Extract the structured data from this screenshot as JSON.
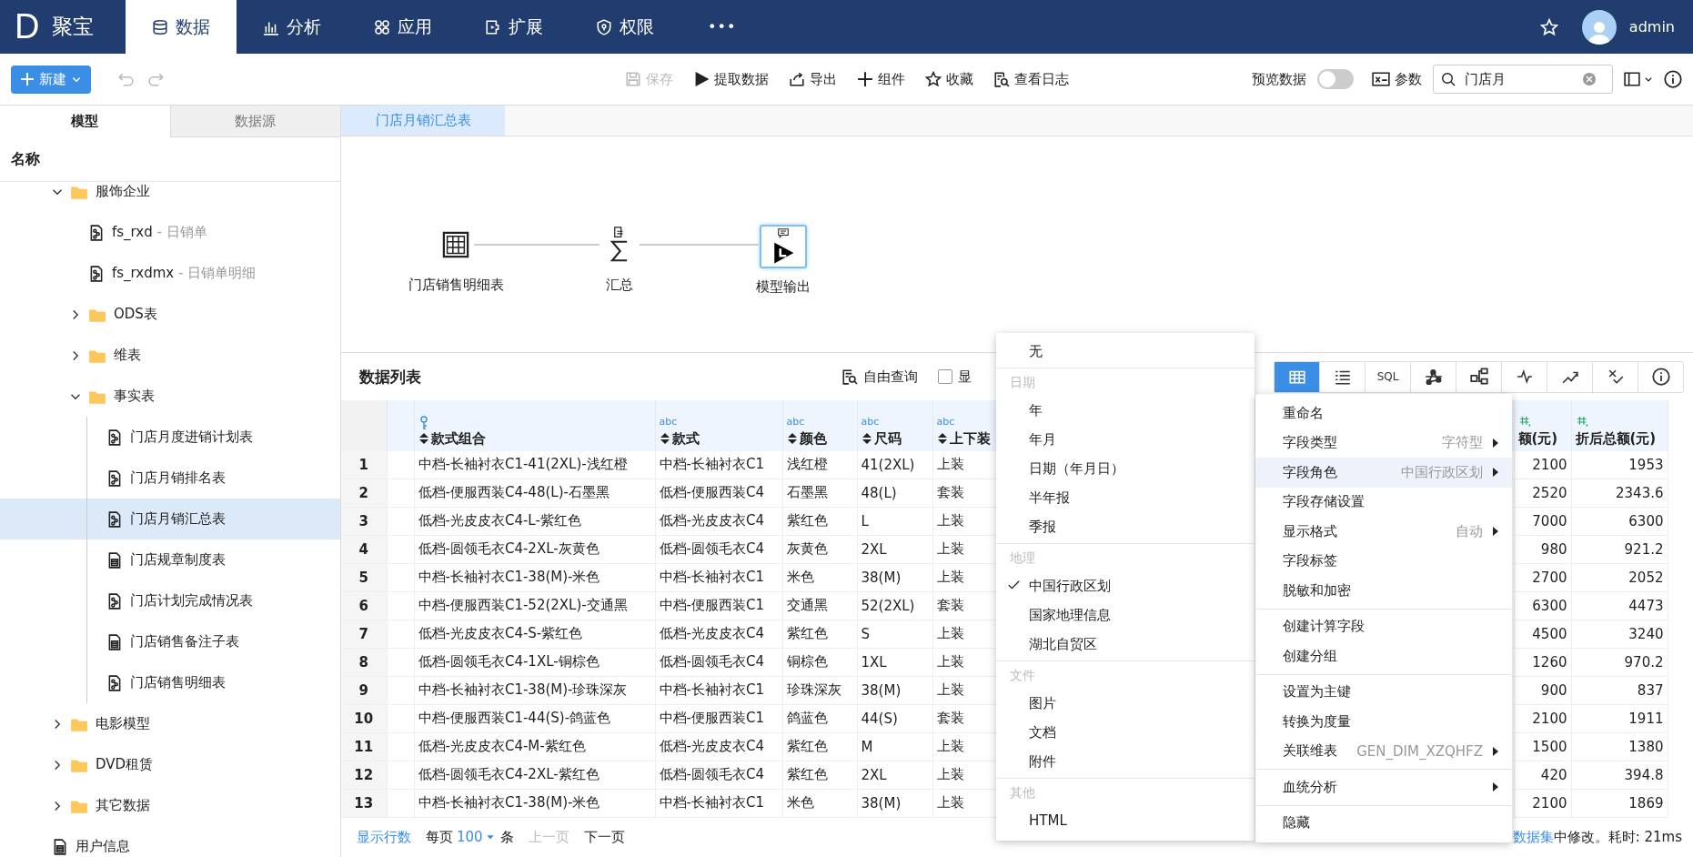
{
  "app": {
    "logo": "D",
    "name": "聚宝"
  },
  "nav": [
    {
      "label": "数据",
      "selected": true
    },
    {
      "label": "分析",
      "selected": false
    },
    {
      "label": "应用",
      "selected": false
    },
    {
      "label": "扩展",
      "selected": false
    },
    {
      "label": "权限",
      "selected": false
    }
  ],
  "nav_more": "•••",
  "user": {
    "name": "admin"
  },
  "toolbar": {
    "new_label": "新建",
    "actions": [
      {
        "label": "保存",
        "disabled": true
      },
      {
        "label": "提取数据",
        "disabled": false
      },
      {
        "label": "导出",
        "disabled": false
      },
      {
        "label": "组件",
        "disabled": false
      },
      {
        "label": "收藏",
        "disabled": false
      },
      {
        "label": "查看日志",
        "disabled": false
      }
    ],
    "preview": {
      "label": "预览数据",
      "on": false
    },
    "params_label": "参数",
    "search": {
      "value": "门店月"
    }
  },
  "sidebar": {
    "tabs": [
      {
        "label": "模型",
        "selected": true
      },
      {
        "label": "数据源",
        "selected": false
      }
    ],
    "header": "名称",
    "tree": [
      {
        "name": "服饰企业",
        "kind": "folder",
        "expanded": true,
        "selected": false,
        "children": [
          {
            "name": "fs_rxd",
            "desc": "- 日销单",
            "kind": "model",
            "selected": false
          },
          {
            "name": "fs_rxdmx",
            "desc": "- 日销单明细",
            "kind": "model",
            "selected": false
          },
          {
            "name": "ODS表",
            "kind": "folder",
            "expanded": false,
            "selected": false
          },
          {
            "name": "维表",
            "kind": "folder",
            "expanded": false,
            "selected": false
          },
          {
            "name": "事实表",
            "kind": "folder",
            "expanded": true,
            "selected": false,
            "children": [
              {
                "name": "门店月度进销计划表",
                "kind": "model",
                "selected": false
              },
              {
                "name": "门店月销排名表",
                "kind": "model",
                "selected": false
              },
              {
                "name": "门店月销汇总表",
                "kind": "model",
                "selected": true
              },
              {
                "name": "门店规章制度表",
                "kind": "table",
                "selected": false
              },
              {
                "name": "门店计划完成情况表",
                "kind": "model",
                "selected": false
              },
              {
                "name": "门店销售备注子表",
                "kind": "table",
                "selected": false
              },
              {
                "name": "门店销售明细表",
                "kind": "model",
                "selected": false
              }
            ]
          }
        ]
      },
      {
        "name": "电影模型",
        "kind": "folder",
        "expanded": false,
        "selected": false
      },
      {
        "name": "DVD租赁",
        "kind": "folder",
        "expanded": false,
        "selected": false
      },
      {
        "name": "其它数据",
        "kind": "folder",
        "expanded": false,
        "selected": false
      },
      {
        "name": "用户信息",
        "kind": "table",
        "selected": false
      }
    ]
  },
  "editor_tabs": [
    {
      "label": "门店月销汇总表",
      "selected": true
    }
  ],
  "flow": {
    "nodes": [
      {
        "label": "门店销售明细表",
        "kind": "source"
      },
      {
        "label": "汇总",
        "kind": "sum"
      },
      {
        "label": "模型输出",
        "kind": "output",
        "selected": true
      }
    ]
  },
  "data_list": {
    "title": "数据列表",
    "query_label": "自由查询",
    "show_checkbox": {
      "label": "显",
      "checked": false
    },
    "views": [
      {
        "selected": true
      },
      {
        "selected": false
      },
      {
        "label": "SQL",
        "selected": false
      },
      {
        "selected": false
      },
      {
        "selected": false
      },
      {
        "selected": false
      },
      {
        "selected": false
      },
      {
        "selected": false
      },
      {
        "selected": false
      }
    ],
    "columns": [
      {
        "label": "款式组合",
        "kind": "key"
      },
      {
        "label": "款式",
        "kind": "text",
        "type": "abc"
      },
      {
        "label": "颜色",
        "kind": "text",
        "type": "abc"
      },
      {
        "label": "尺码",
        "kind": "text",
        "type": "abc"
      },
      {
        "label": "上下装",
        "kind": "text",
        "type": "abc"
      },
      {
        "label": "额(元)",
        "kind": "number"
      },
      {
        "label": "折后总额(元)",
        "kind": "number"
      }
    ],
    "rows": [
      {
        "num": "1",
        "cells": [
          "中档-长袖衬衣C1-41(2XL)-浅红橙",
          "中档-长袖衬衣C1",
          "浅红橙",
          "41(2XL)",
          "上装",
          "2100",
          "1953"
        ]
      },
      {
        "num": "2",
        "cells": [
          "低档-便服西装C4-48(L)-石墨黑",
          "低档-便服西装C4",
          "石墨黑",
          "48(L)",
          "套装",
          "2520",
          "2343.6"
        ]
      },
      {
        "num": "3",
        "cells": [
          "低档-光皮皮衣C4-L-紫红色",
          "低档-光皮皮衣C4",
          "紫红色",
          "L",
          "上装",
          "7000",
          "6300"
        ]
      },
      {
        "num": "4",
        "cells": [
          "低档-圆领毛衣C4-2XL-灰黄色",
          "低档-圆领毛衣C4",
          "灰黄色",
          "2XL",
          "上装",
          "980",
          "921.2"
        ]
      },
      {
        "num": "5",
        "cells": [
          "中档-长袖衬衣C1-38(M)-米色",
          "中档-长袖衬衣C1",
          "米色",
          "38(M)",
          "上装",
          "2700",
          "2052"
        ]
      },
      {
        "num": "6",
        "cells": [
          "中档-便服西装C1-52(2XL)-交通黑",
          "中档-便服西装C1",
          "交通黑",
          "52(2XL)",
          "套装",
          "6300",
          "4473"
        ]
      },
      {
        "num": "7",
        "cells": [
          "低档-光皮皮衣C4-S-紫红色",
          "低档-光皮皮衣C4",
          "紫红色",
          "S",
          "上装",
          "4500",
          "3240"
        ]
      },
      {
        "num": "8",
        "cells": [
          "低档-圆领毛衣C4-1XL-铜棕色",
          "低档-圆领毛衣C4",
          "铜棕色",
          "1XL",
          "上装",
          "1260",
          "970.2"
        ]
      },
      {
        "num": "9",
        "cells": [
          "中档-长袖衬衣C1-38(M)-珍珠深灰",
          "中档-长袖衬衣C1",
          "珍珠深灰",
          "38(M)",
          "上装",
          "900",
          "837"
        ]
      },
      {
        "num": "10",
        "cells": [
          "中档-便服西装C1-44(S)-鸽蓝色",
          "中档-便服西装C1",
          "鸽蓝色",
          "44(S)",
          "套装",
          "2100",
          "1911"
        ]
      },
      {
        "num": "11",
        "cells": [
          "低档-光皮皮衣C4-M-紫红色",
          "低档-光皮皮衣C4",
          "紫红色",
          "M",
          "上装",
          "1500",
          "1380"
        ]
      },
      {
        "num": "12",
        "cells": [
          "低档-圆领毛衣C4-2XL-紫红色",
          "低档-圆领毛衣C4",
          "紫红色",
          "2XL",
          "上装",
          "420",
          "394.8"
        ]
      },
      {
        "num": "13",
        "cells": [
          "中档-长袖衬衣C1-38(M)-米色",
          "中档-长袖衬衣C1",
          "米色",
          "38(M)",
          "上装",
          "2100",
          "1869"
        ]
      }
    ],
    "footer": {
      "rows_link": "显示行数",
      "per_page": "每页",
      "page_size": "100",
      "unit": "条",
      "prev": "上一页",
      "prev_disabled": true,
      "next": "下一页",
      "next_disabled": false,
      "status_link": "数据集",
      "status_text": "中修改。耗时: 21ms"
    }
  },
  "role_menu": {
    "sections": [
      {
        "items": [
          {
            "label": "无",
            "checked": false
          }
        ]
      },
      {
        "heading": "日期",
        "items": [
          {
            "label": "年",
            "checked": false
          },
          {
            "label": "年月",
            "checked": false
          },
          {
            "label": "日期（年月日）",
            "checked": false
          },
          {
            "label": "半年报",
            "checked": false
          },
          {
            "label": "季报",
            "checked": false
          }
        ]
      },
      {
        "heading": "地理",
        "items": [
          {
            "label": "中国行政区划",
            "checked": true
          },
          {
            "label": "国家地理信息",
            "checked": false
          },
          {
            "label": "湖北自贸区",
            "checked": false
          }
        ]
      },
      {
        "heading": "文件",
        "items": [
          {
            "label": "图片",
            "checked": false
          },
          {
            "label": "文档",
            "checked": false
          },
          {
            "label": "附件",
            "checked": false
          }
        ]
      },
      {
        "heading": "其他",
        "items": [
          {
            "label": "HTML",
            "checked": false
          }
        ]
      }
    ]
  },
  "context_menu": {
    "groups": [
      [
        {
          "label": "重命名",
          "submenu": false,
          "selected": false
        },
        {
          "label": "字段类型",
          "value": "字符型",
          "submenu": true,
          "selected": false
        },
        {
          "label": "字段角色",
          "value": "中国行政区划",
          "submenu": true,
          "selected": true
        },
        {
          "label": "字段存储设置",
          "submenu": false,
          "selected": false
        },
        {
          "label": "显示格式",
          "value": "自动",
          "submenu": true,
          "selected": false
        },
        {
          "label": "字段标签",
          "submenu": false,
          "selected": false
        },
        {
          "label": "脱敏和加密",
          "submenu": false,
          "selected": false
        }
      ],
      [
        {
          "label": "创建计算字段",
          "submenu": false,
          "selected": false
        },
        {
          "label": "创建分组",
          "submenu": false,
          "selected": false
        }
      ],
      [
        {
          "label": "设置为主键",
          "submenu": false,
          "selected": false
        },
        {
          "label": "转换为度量",
          "submenu": false,
          "selected": false
        },
        {
          "label": "关联维表",
          "value": "GEN_DIM_XZQHFZ",
          "submenu": true,
          "selected": false
        }
      ],
      [
        {
          "label": "血统分析",
          "submenu": true,
          "selected": false
        }
      ],
      [
        {
          "label": "隐藏",
          "submenu": false,
          "selected": false
        }
      ]
    ]
  }
}
